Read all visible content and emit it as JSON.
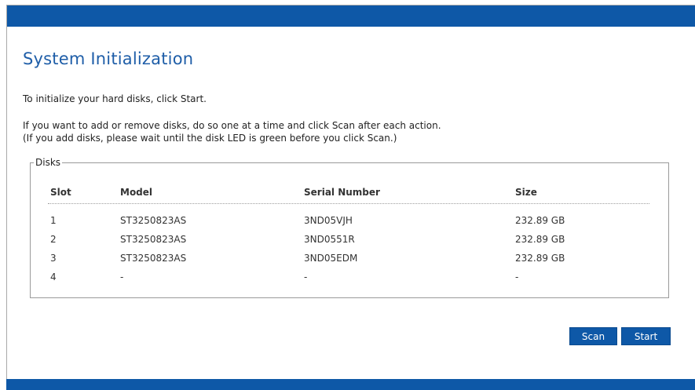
{
  "page": {
    "title": "System Initialization",
    "instruction_start": "To initialize your hard disks, click Start.",
    "instruction_scan_1": "If you want to add or remove disks, do so one at a time and click Scan after each action.",
    "instruction_scan_2": "(If you add disks, please wait until the disk LED is green before you click Scan.)"
  },
  "disks": {
    "legend": "Disks",
    "columns": {
      "slot": "Slot",
      "model": "Model",
      "serial": "Serial Number",
      "size": "Size"
    },
    "rows": [
      {
        "slot": "1",
        "model": "ST3250823AS",
        "serial": "3ND05VJH",
        "size": "232.89 GB"
      },
      {
        "slot": "2",
        "model": "ST3250823AS",
        "serial": "3ND0551R",
        "size": "232.89 GB"
      },
      {
        "slot": "3",
        "model": "ST3250823AS",
        "serial": "3ND05EDM",
        "size": "232.89 GB"
      },
      {
        "slot": "4",
        "model": "-",
        "serial": "-",
        "size": "-"
      }
    ]
  },
  "actions": {
    "scan_label": "Scan",
    "start_label": "Start"
  },
  "colors": {
    "brand_blue": "#0e58a7",
    "title_blue": "#1f5ea8"
  }
}
